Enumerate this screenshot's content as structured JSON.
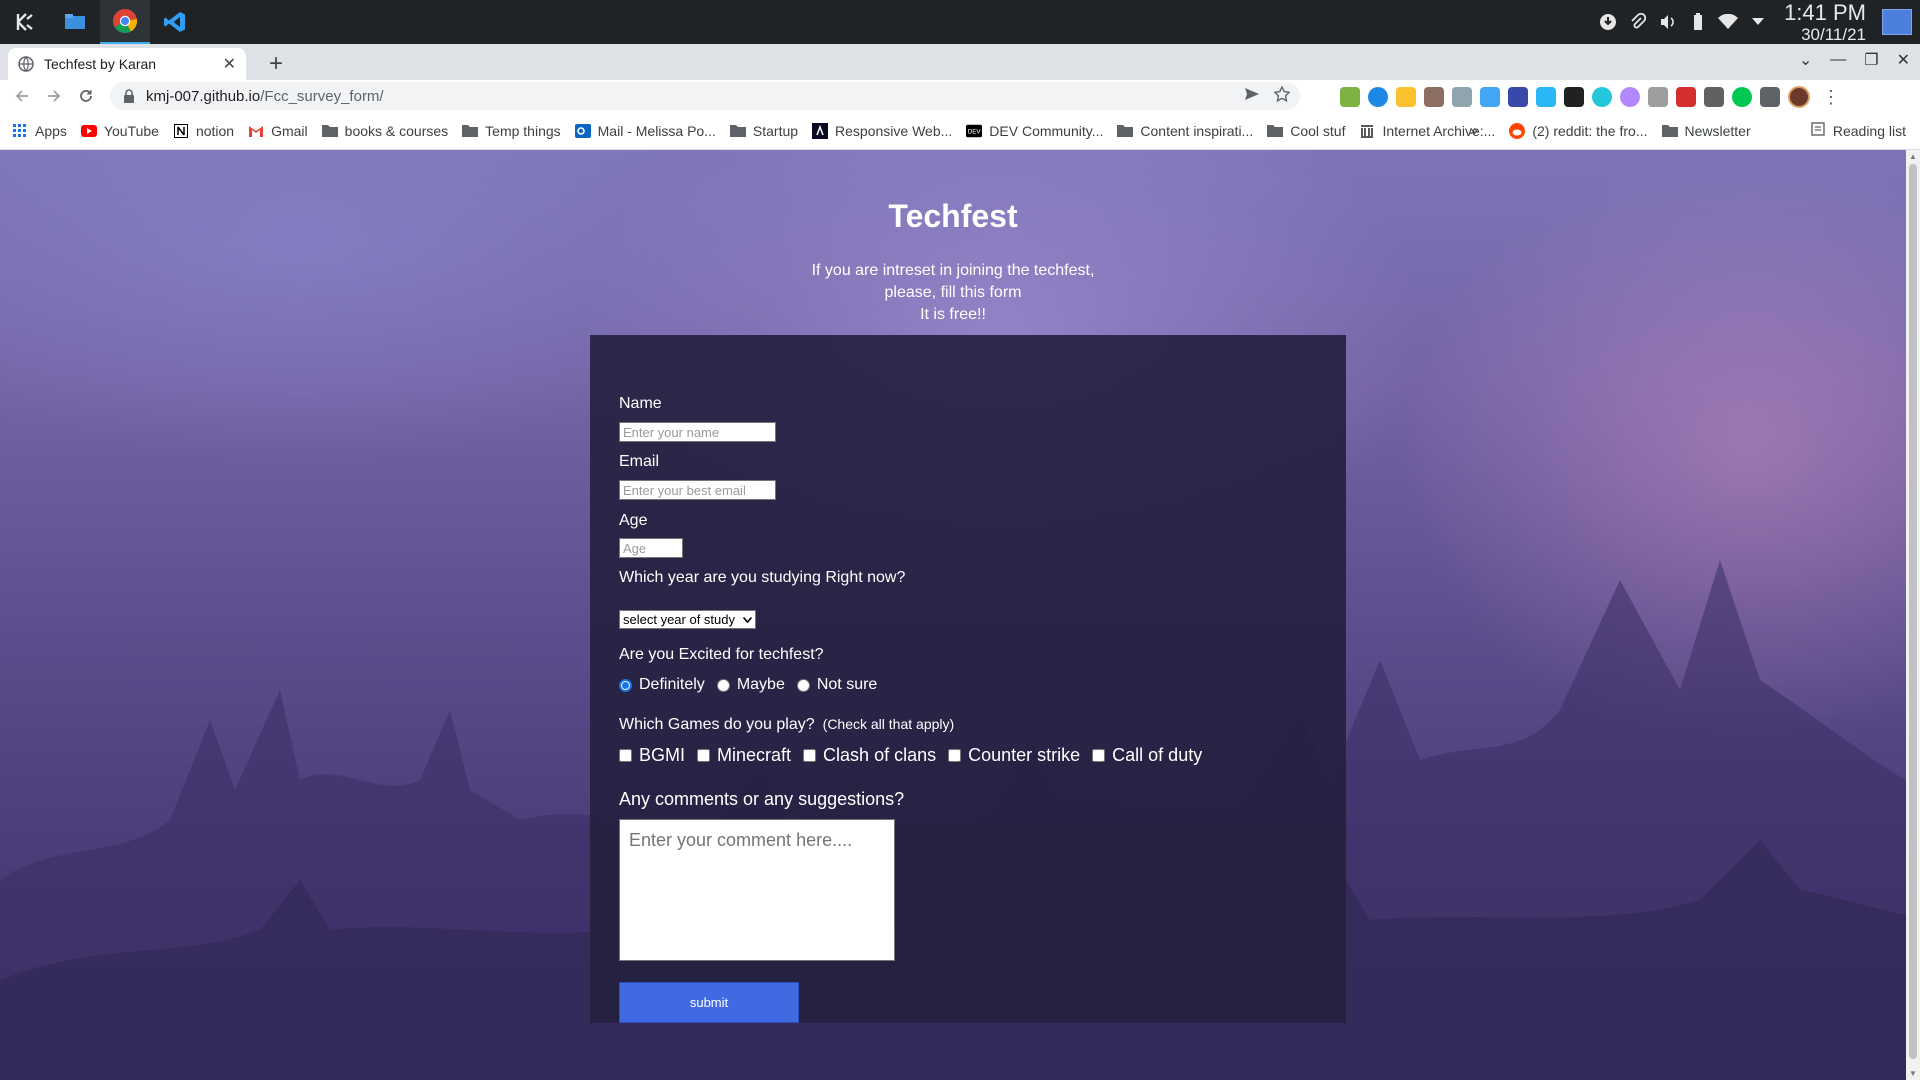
{
  "os": {
    "clock_time": "1:41 PM",
    "clock_date": "30/11/21"
  },
  "browser": {
    "tab_title": "Techfest by Karan",
    "url_host": "kmj-007.github.io",
    "url_path": "/Fcc_survey_form/",
    "bookmarks": [
      {
        "label": "Apps",
        "icon": "apps-grid-icon"
      },
      {
        "label": "YouTube",
        "icon": "youtube-icon"
      },
      {
        "label": "notion",
        "icon": "notion-icon"
      },
      {
        "label": "Gmail",
        "icon": "gmail-icon"
      },
      {
        "label": "books & courses",
        "icon": "folder-icon"
      },
      {
        "label": "Temp things",
        "icon": "folder-icon"
      },
      {
        "label": "Mail - Melissa Po...",
        "icon": "outlook-icon"
      },
      {
        "label": "Startup",
        "icon": "folder-icon"
      },
      {
        "label": "Responsive Web...",
        "icon": "fcc-icon"
      },
      {
        "label": "DEV Community...",
        "icon": "dev-icon"
      },
      {
        "label": "Content inspirati...",
        "icon": "folder-icon"
      },
      {
        "label": "Cool stuf",
        "icon": "folder-icon"
      },
      {
        "label": "Internet Archive:...",
        "icon": "archive-icon"
      },
      {
        "label": "(2) reddit: the fro...",
        "icon": "reddit-icon"
      },
      {
        "label": "Newsletter",
        "icon": "folder-icon"
      }
    ],
    "bookmarks_more": "»",
    "reading_list": "Reading list"
  },
  "page": {
    "heading": "Techfest",
    "intro_line1": "If you are intreset in joining the techfest,",
    "intro_line2": "please, fill this form",
    "intro_line3": "It is free!!",
    "form": {
      "name_label": "Name",
      "name_placeholder": "Enter your name",
      "email_label": "Email",
      "email_placeholder": "Enter your best email",
      "age_label": "Age",
      "age_placeholder": "Age",
      "year_label": "Which year are you studying Right now?",
      "year_selected": "select year of study",
      "excited_label": "Are you Excited for techfest?",
      "excited_options": [
        "Definitely",
        "Maybe",
        "Not sure"
      ],
      "excited_selected": "Definitely",
      "games_label": "Which Games do you play?",
      "games_note": "(Check all that apply)",
      "games_options": [
        "BGMI",
        "Minecraft",
        "Clash of clans",
        "Counter strike",
        "Call of duty"
      ],
      "comments_label": "Any comments or any suggestions?",
      "comments_placeholder": "Enter your comment here....",
      "submit_label": "submit"
    }
  },
  "colors": {
    "submit_bg": "#4169e1",
    "form_bg": "#24203e",
    "radio_accent": "#1a73e8"
  }
}
